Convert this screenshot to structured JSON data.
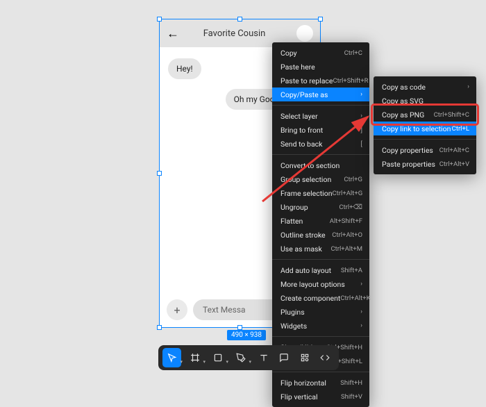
{
  "canvas": {
    "selectionSize": "490 × 938"
  },
  "phone": {
    "title": "Favorite Cousin",
    "bubbles": {
      "left": "Hey!",
      "right": "Oh my Goodness! I"
    },
    "inputPlaceholder": "Text Messa"
  },
  "contextMenu": [
    {
      "label": "Copy",
      "shortcut": "Ctrl+C",
      "sub": false,
      "hl": false,
      "sep": false
    },
    {
      "label": "Paste here",
      "shortcut": "",
      "sub": false,
      "hl": false,
      "sep": false
    },
    {
      "label": "Paste to replace",
      "shortcut": "Ctrl+Shift+R",
      "sub": false,
      "hl": false,
      "sep": false
    },
    {
      "label": "Copy/Paste as",
      "shortcut": "",
      "sub": true,
      "hl": true,
      "sep": false
    },
    {
      "sep": true
    },
    {
      "label": "Select layer",
      "shortcut": "",
      "sub": true,
      "hl": false,
      "sep": false
    },
    {
      "label": "Bring to front",
      "shortcut": "]",
      "sub": false,
      "hl": false,
      "sep": false
    },
    {
      "label": "Send to back",
      "shortcut": "[",
      "sub": false,
      "hl": false,
      "sep": false
    },
    {
      "sep": true
    },
    {
      "label": "Convert to section",
      "shortcut": "",
      "sub": false,
      "hl": false,
      "sep": false
    },
    {
      "label": "Group selection",
      "shortcut": "Ctrl+G",
      "sub": false,
      "hl": false,
      "sep": false
    },
    {
      "label": "Frame selection",
      "shortcut": "Ctrl+Alt+G",
      "sub": false,
      "hl": false,
      "sep": false
    },
    {
      "label": "Ungroup",
      "shortcut": "Ctrl+⌫",
      "sub": false,
      "hl": false,
      "sep": false
    },
    {
      "label": "Flatten",
      "shortcut": "Alt+Shift+F",
      "sub": false,
      "hl": false,
      "sep": false
    },
    {
      "label": "Outline stroke",
      "shortcut": "Ctrl+Alt+O",
      "sub": false,
      "hl": false,
      "sep": false
    },
    {
      "label": "Use as mask",
      "shortcut": "Ctrl+Alt+M",
      "sub": false,
      "hl": false,
      "sep": false
    },
    {
      "sep": true
    },
    {
      "label": "Add auto layout",
      "shortcut": "Shift+A",
      "sub": false,
      "hl": false,
      "sep": false
    },
    {
      "label": "More layout options",
      "shortcut": "",
      "sub": true,
      "hl": false,
      "sep": false
    },
    {
      "label": "Create component",
      "shortcut": "Ctrl+Alt+K",
      "sub": false,
      "hl": false,
      "sep": false
    },
    {
      "label": "Plugins",
      "shortcut": "",
      "sub": true,
      "hl": false,
      "sep": false
    },
    {
      "label": "Widgets",
      "shortcut": "",
      "sub": true,
      "hl": false,
      "sep": false
    },
    {
      "sep": true
    },
    {
      "label": "Show/Hide",
      "shortcut": "Ctrl+Shift+H",
      "sub": false,
      "hl": false,
      "sep": false
    },
    {
      "label": "Lock/Unlock",
      "shortcut": "Ctrl+Shift+L",
      "sub": false,
      "hl": false,
      "sep": false
    },
    {
      "sep": true
    },
    {
      "label": "Flip horizontal",
      "shortcut": "Shift+H",
      "sub": false,
      "hl": false,
      "sep": false
    },
    {
      "label": "Flip vertical",
      "shortcut": "Shift+V",
      "sub": false,
      "hl": false,
      "sep": false
    }
  ],
  "submenu": [
    {
      "label": "Copy as code",
      "shortcut": "",
      "sub": true,
      "hl": false,
      "sep": false
    },
    {
      "label": "Copy as SVG",
      "shortcut": "",
      "sub": false,
      "hl": false,
      "sep": false
    },
    {
      "label": "Copy as PNG",
      "shortcut": "Ctrl+Shift+C",
      "sub": false,
      "hl": false,
      "sep": false
    },
    {
      "label": "Copy link to selection",
      "shortcut": "Ctrl+L",
      "sub": false,
      "hl": true,
      "sep": false
    },
    {
      "sep": true
    },
    {
      "label": "Copy properties",
      "shortcut": "Ctrl+Alt+C",
      "sub": false,
      "hl": false,
      "sep": false
    },
    {
      "label": "Paste properties",
      "shortcut": "Ctrl+Alt+V",
      "sub": false,
      "hl": false,
      "sep": false
    }
  ],
  "toolbar": {
    "items": [
      "move",
      "frame",
      "shape",
      "pen",
      "text",
      "comment",
      "actions",
      "dev"
    ]
  }
}
